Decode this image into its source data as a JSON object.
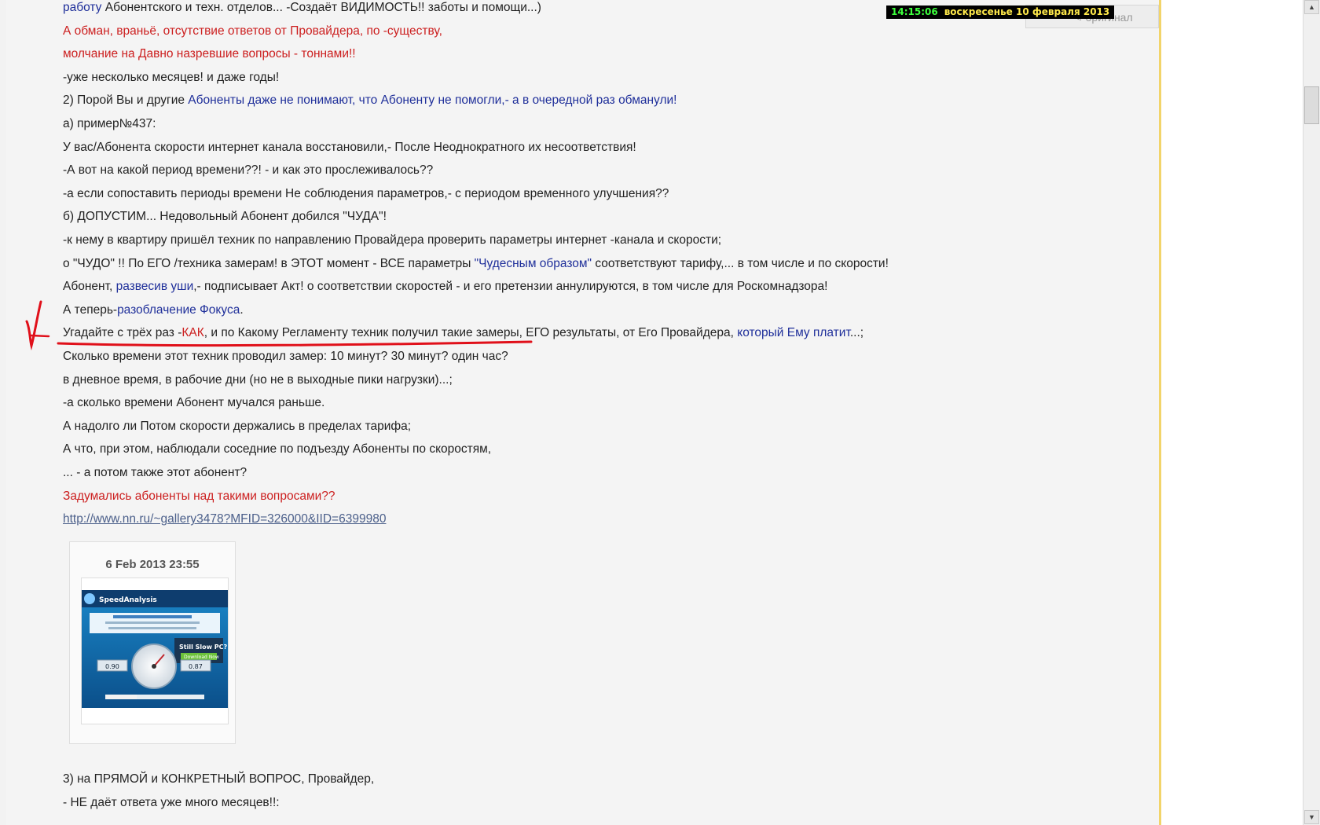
{
  "clock": {
    "time": "14:15:06",
    "date": "воскресенье 10 февраля 2013"
  },
  "original_button": {
    "label": "оригинал",
    "icon": "pencil-icon"
  },
  "lines": [
    [
      {
        "t": "работу",
        "c": "blue"
      },
      {
        "t": " Абонентского и техн. отделов... -Создаёт ВИДИМОСТЬ!! заботы и помощи...)"
      }
    ],
    [
      {
        "t": "А обман, враньё, отсутствие ответов от Провайдера, по -существу,",
        "c": "red"
      }
    ],
    [
      {
        "t": "молчание на Давно назревшие вопросы - тоннами!!",
        "c": "red"
      }
    ],
    [
      {
        "t": "-уже несколько месяцев! и даже годы!"
      }
    ],
    [
      {
        "t": "2) Порой Вы и другие "
      },
      {
        "t": "Абоненты даже не понимают, что Абоненту не помогли,- а в очередной раз обманули!",
        "c": "blue"
      }
    ],
    [
      {
        "t": "а) пример№437:"
      }
    ],
    [
      {
        "t": "У вас/Абонента скорости интернет канала восстановили,- После Неоднократного их несоответствия!"
      }
    ],
    [
      {
        "t": "-А вот на какой период времени??! - и как это прослеживалось??"
      }
    ],
    [
      {
        "t": "-а если сопоставить периоды времени Не соблюдения параметров,- с периодом временного улучшения??"
      }
    ],
    [
      {
        "t": "б) ДОПУСТИМ... Недовольный Абонент добился \"ЧУДА\"!"
      }
    ],
    [
      {
        "t": "-к нему в квартиру пришёл техник по направлению Провайдера проверить параметры интернет -канала и скорости;"
      }
    ],
    [
      {
        "t": "о \"ЧУДО\" !! По ЕГО /техника замерам! в ЭТОТ момент - ВСЕ параметры "
      },
      {
        "t": "\"Чудесным образом\"",
        "c": "blue"
      },
      {
        "t": " соответствуют тарифу,... в том числе и по скорости!"
      }
    ],
    [
      {
        "t": "Абонент, "
      },
      {
        "t": "развесив уши",
        "c": "blue"
      },
      {
        "t": ",- подписывает Акт! о соответствии скоростей - и его претензии аннулируются, в том числе для Роскомнадзора!"
      }
    ],
    [
      {
        "t": "А теперь-"
      },
      {
        "t": "разоблачение Фокуса",
        "c": "blue"
      },
      {
        "t": "."
      }
    ],
    [
      {
        "t": "Угадайте с трёх раз -"
      },
      {
        "t": "КАК",
        "c": "red"
      },
      {
        "t": ", и по Какому Регламенту техник получил такие замеры, ЕГО результаты, от Его Провайдера, "
      },
      {
        "t": "который Ему платит",
        "c": "blue"
      },
      {
        "t": "...;"
      }
    ],
    [
      {
        "t": "Сколько времени этот техник проводил замер: 10 минут? 30 минут? один час?"
      }
    ],
    [
      {
        "t": "в дневное время, в рабочие дни (но не в выходные пики нагрузки)...;"
      }
    ],
    [
      {
        "t": "-а сколько времени Абонент мучался раньше."
      }
    ],
    [
      {
        "t": "А надолго ли Потом скорости держались в пределах тарифа;"
      }
    ],
    [
      {
        "t": "А что, при этом, наблюдали соседние по подъезду Абоненты по скоростям,"
      }
    ],
    [
      {
        "t": "... - а потом также этот абонент?"
      }
    ],
    [
      {
        "t": "Задумались абоненты над такими вопросами??",
        "c": "red"
      }
    ],
    [
      {
        "t": "http://www.nn.ru/~gallery3478?MFID=326000&IID=6399980",
        "c": "link"
      }
    ]
  ],
  "photo": {
    "date": "6 Feb 2013 23:55",
    "thumb_title": "SpeedAnalysis",
    "thumb_banner": "Still Slow PC?",
    "thumb_button": "Download Now",
    "left_value": "0.90",
    "right_value": "0.87"
  },
  "bottom_lines": [
    [
      {
        "t": "3) на ПРЯМОЙ и КОНКРЕТНЫЙ ВОПРОС, Провайдер,"
      }
    ],
    [
      {
        "t": "- НЕ даёт ответа уже много месяцев!!:"
      }
    ]
  ],
  "colors": {
    "blue": "#1f2f9a",
    "red": "#cc1f1f",
    "annotation": "#e0101a"
  }
}
